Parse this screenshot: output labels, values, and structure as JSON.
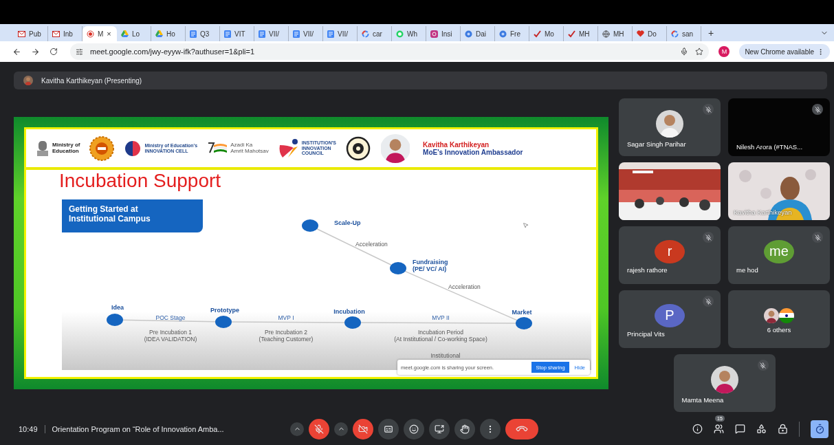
{
  "browser": {
    "tabs": [
      {
        "kind": "mail",
        "title": "Pub",
        "selected": false
      },
      {
        "kind": "mail",
        "title": "Inb",
        "selected": false
      },
      {
        "kind": "record",
        "title": "M",
        "selected": true,
        "close": "×"
      },
      {
        "kind": "drive",
        "title": "Lo",
        "selected": false
      },
      {
        "kind": "drive",
        "title": "Ho",
        "selected": false
      },
      {
        "kind": "docs",
        "title": "Q3",
        "selected": false
      },
      {
        "kind": "docs",
        "title": "VIT",
        "selected": false
      },
      {
        "kind": "docs",
        "title": "VII/",
        "selected": false
      },
      {
        "kind": "docs",
        "title": "VII/",
        "selected": false
      },
      {
        "kind": "docs",
        "title": "VII/",
        "selected": false
      },
      {
        "kind": "google",
        "title": "car",
        "selected": false
      },
      {
        "kind": "chat",
        "title": "Wh",
        "selected": false
      },
      {
        "kind": "camera",
        "title": "Insi",
        "selected": false
      },
      {
        "kind": "blue",
        "title": "Dai",
        "selected": false
      },
      {
        "kind": "blue",
        "title": "Fre",
        "selected": false
      },
      {
        "kind": "check",
        "title": "Mo",
        "selected": false
      },
      {
        "kind": "check",
        "title": "MH",
        "selected": false
      },
      {
        "kind": "globe",
        "title": "MH",
        "selected": false
      },
      {
        "kind": "heart",
        "title": "Do",
        "selected": false
      },
      {
        "kind": "google",
        "title": "san",
        "selected": false
      }
    ],
    "new_tab": "+",
    "url": "meet.google.com/jwy-eyyw-ifk?authuser=1&pli=1",
    "profile": "M",
    "update_button": "New Chrome available"
  },
  "meeting": {
    "presenter": "Kavitha Karthikeyan (Presenting)",
    "slide": {
      "logos": [
        {
          "kind": "emblem",
          "text": "Ministry of\nEducation"
        },
        {
          "kind": "seal"
        },
        {
          "kind": "brain",
          "text": "Ministry of Education's\nINNOVATION CELL"
        },
        {
          "kind": "flag",
          "text": "Azadi Ka\nAmrit Mahotsav"
        },
        {
          "kind": "swoosh",
          "text": "INSTITUTION'S\nINNOVATION\nCOUNCIL"
        },
        {
          "kind": "round"
        }
      ],
      "ambassador": {
        "name": "Kavitha Karthikeyan",
        "role": "MoE's Innovation Ambassador"
      },
      "title": "Incubation Support",
      "callout": "Getting Started at\nInstitutional Campus",
      "nodes": [
        {
          "label": "Scale-Up"
        },
        {
          "label": "Fundraising\n(PE/ VC/ AI)"
        },
        {
          "label": "Idea"
        },
        {
          "label": "Prototype"
        },
        {
          "label": "Incubation"
        },
        {
          "label": "Market"
        }
      ],
      "edge_labels": [
        "Acceleration",
        "Acceleration"
      ],
      "phases": [
        {
          "stage": "POC Stage",
          "period": "Pre Incubation 1\n(IDEA VALIDATION)"
        },
        {
          "stage": "MVP I",
          "period": "Pre Incubation 2\n(Teaching Customer)"
        },
        {
          "stage": "MVP II",
          "period": "Incubation Period\n(At Institutional / Co-working Space)"
        }
      ],
      "note": "Institutional",
      "share_notice": {
        "text": "meet.google.com is sharing your screen.",
        "stop": "Stop sharing",
        "hide": "Hide"
      }
    },
    "participants": [
      {
        "name": "Sagar Singh Parihar",
        "muted": true
      },
      {
        "kind": "blank",
        "name": "Nilesh Arora (#TNAS...",
        "muted": true
      },
      {
        "kind": "hall"
      },
      {
        "kind": "room",
        "name": "Kavitha Karthikeyan"
      },
      {
        "kind": "letter",
        "initial": "r",
        "color": "#c9391f",
        "name": "rajesh rathore",
        "muted": true
      },
      {
        "kind": "letter",
        "initial": "me",
        "color": "#5f9d34",
        "name": "me hod",
        "muted": true
      },
      {
        "kind": "letter",
        "initial": "P",
        "color": "#5a67c4",
        "name": "Principal Vits",
        "muted": true
      },
      {
        "kind": "others",
        "name": "6 others"
      },
      {
        "name": "Mamta Meena",
        "muted": true
      }
    ]
  },
  "footer": {
    "time": "10:49",
    "title": "Orientation Program on “Role of Innovation Amba...",
    "mic_on": false,
    "camera_on": false,
    "people_count": "15"
  }
}
